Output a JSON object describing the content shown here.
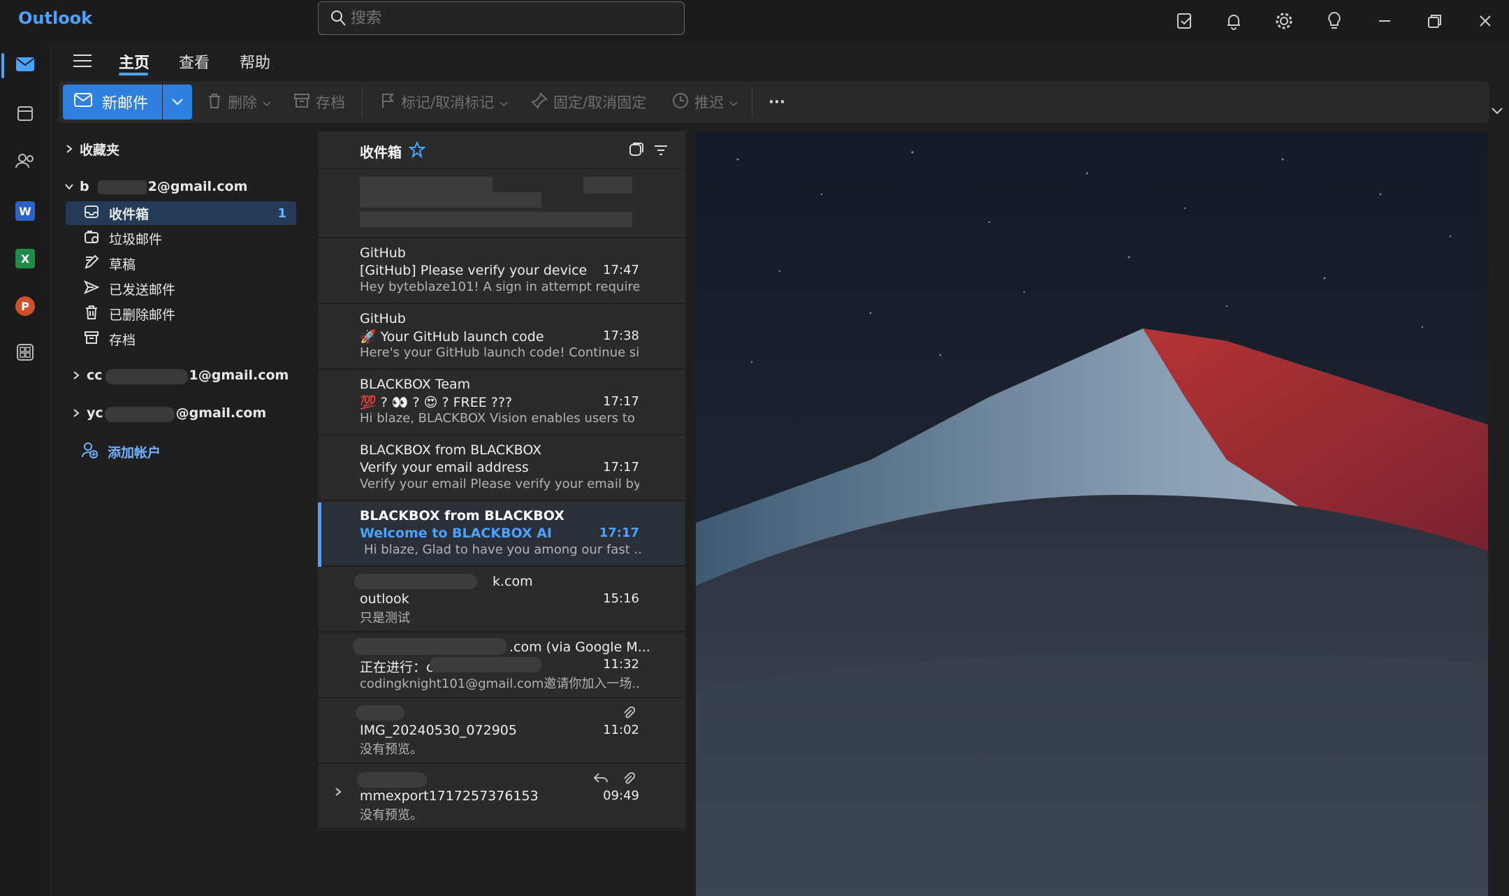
{
  "app": {
    "title": "Outlook"
  },
  "search": {
    "placeholder": "搜索"
  },
  "menu_tabs": [
    {
      "label": "主页",
      "active": true
    },
    {
      "label": "查看",
      "active": false
    },
    {
      "label": "帮助",
      "active": false
    }
  ],
  "ribbon": {
    "new_mail": "新邮件",
    "delete": "删除",
    "archive": "存档",
    "flag": "标记/取消标记",
    "pin": "固定/取消固定",
    "snooze": "推迟",
    "more": "···"
  },
  "folders": {
    "favorites": "收藏夹",
    "account1": {
      "prefix": "b",
      "suffix": "2@gmail.com"
    },
    "items": [
      {
        "label": "收件箱",
        "count": "1",
        "selected": true,
        "icon": "inbox-icon"
      },
      {
        "label": "垃圾邮件",
        "count": "",
        "selected": false,
        "icon": "junk-icon"
      },
      {
        "label": "草稿",
        "count": "",
        "selected": false,
        "icon": "draft-icon"
      },
      {
        "label": "已发送邮件",
        "count": "",
        "selected": false,
        "icon": "sent-icon"
      },
      {
        "label": "已删除邮件",
        "count": "",
        "selected": false,
        "icon": "trash-icon"
      },
      {
        "label": "存档",
        "count": "",
        "selected": false,
        "icon": "archive-icon"
      }
    ],
    "account2": {
      "prefix": "cc",
      "suffix": "1@gmail.com"
    },
    "account3": {
      "prefix": "yc",
      "suffix": "@gmail.com"
    },
    "add_account": "添加帐户"
  },
  "list": {
    "title": "收件箱",
    "messages": [
      {
        "sender": "GitHub",
        "subject": "[GitHub] Please verify your device",
        "time": "17:47",
        "preview": "Hey byteblaze101! A sign in attempt require...",
        "unread": false
      },
      {
        "sender": "GitHub",
        "subject": "🚀 Your GitHub launch code",
        "time": "17:38",
        "preview": "Here's your GitHub launch code! Continue si...",
        "unread": false
      },
      {
        "sender": "BLACKBOX Team",
        "subject": "💯 ? 👀 ? 😍 ? FREE ???",
        "time": "17:17",
        "preview": "Hi blaze, BLACKBOX Vision enables users to ...",
        "unread": false
      },
      {
        "sender": "BLACKBOX from BLACKBOX",
        "subject": "Verify your email address",
        "time": "17:17",
        "preview": "Verify your email Please verify your email by...",
        "unread": false
      },
      {
        "sender": "BLACKBOX from BLACKBOX",
        "subject": "Welcome to BLACKBOX AI",
        "time": "17:17",
        "preview": "Hi blaze, Glad to have you among our fast ...",
        "unread": true
      },
      {
        "sender": "k.com",
        "subject": "outlook",
        "time": "15:16",
        "preview": "只是测试",
        "unread": false
      },
      {
        "sender": ".com (via Google M...",
        "subject": "正在进行：cc                        nail.c...",
        "time": "11:32",
        "preview": "codingknight101@gmail.com邀请你加入一场...",
        "unread": false
      },
      {
        "sender": "",
        "subject": "IMG_20240530_072905",
        "time": "11:02",
        "preview": "没有预览。",
        "unread": false,
        "attachment": true
      },
      {
        "sender": "",
        "subject": "mmexport1717257376153",
        "time": "09:49",
        "preview": "没有预览。",
        "unread": false,
        "attachment": true,
        "replied": true
      }
    ]
  },
  "colors": {
    "accent": "#4aa3ff",
    "button": "#2f7fe0",
    "selected": "#243a56"
  }
}
